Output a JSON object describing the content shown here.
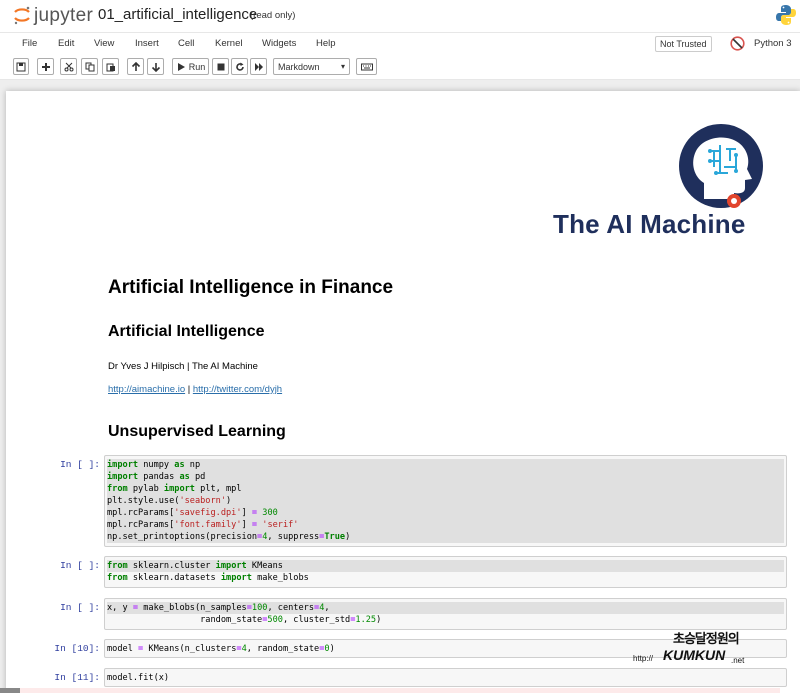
{
  "header": {
    "logo_text": "jupyter",
    "notebook_name": "01_artificial_intelligence",
    "read_only": "(read only)"
  },
  "menu": {
    "items": [
      "File",
      "Edit",
      "View",
      "Insert",
      "Cell",
      "Kernel",
      "Widgets",
      "Help"
    ],
    "not_trusted": "Not Trusted",
    "kernel": "Python 3"
  },
  "toolbar": {
    "run_label": "Run",
    "cell_type": "Markdown"
  },
  "notebook": {
    "brand": "The AI Machine",
    "title": "Artificial Intelligence in Finance",
    "subtitle": "Artificial Intelligence",
    "author": "Dr Yves J Hilpisch | The AI Machine",
    "link1": "http://aimachine.io",
    "link_sep": " | ",
    "link2": "http://twitter.com/dyjh",
    "section": "Unsupervised Learning"
  },
  "cells": [
    {
      "prompt": "In [ ]:"
    },
    {
      "prompt": "In [ ]:"
    },
    {
      "prompt": "In [ ]:"
    },
    {
      "prompt": "In [10]:"
    },
    {
      "prompt": "In [11]:"
    }
  ],
  "code_text": {
    "c1": [
      "import numpy as np",
      "import pandas as pd",
      "from pylab import plt, mpl",
      "plt.style.use('seaborn')",
      "mpl.rcParams['savefig.dpi'] = 300",
      "mpl.rcParams['font.family'] = 'serif'",
      "np.set_printoptions(precision=4, suppress=True)"
    ],
    "c2": [
      "from sklearn.cluster import KMeans",
      "from sklearn.datasets import make_blobs"
    ],
    "c3": [
      "x, y = make_blobs(n_samples=100, centers=4,",
      "                  random_state=500, cluster_std=1.25)"
    ],
    "c4": [
      "model = KMeans(n_clusters=4, random_state=0)"
    ],
    "c5": [
      "model.fit(x)"
    ]
  },
  "watermark": {
    "top": "초승달정원의",
    "url": "http://",
    "name": "KUMKUN",
    "tld": ".net"
  },
  "colors": {
    "brand": "#1f2f5c",
    "prompt": "#303f9f",
    "link": "#296eaa",
    "jupyter_orange": "#f37726"
  }
}
